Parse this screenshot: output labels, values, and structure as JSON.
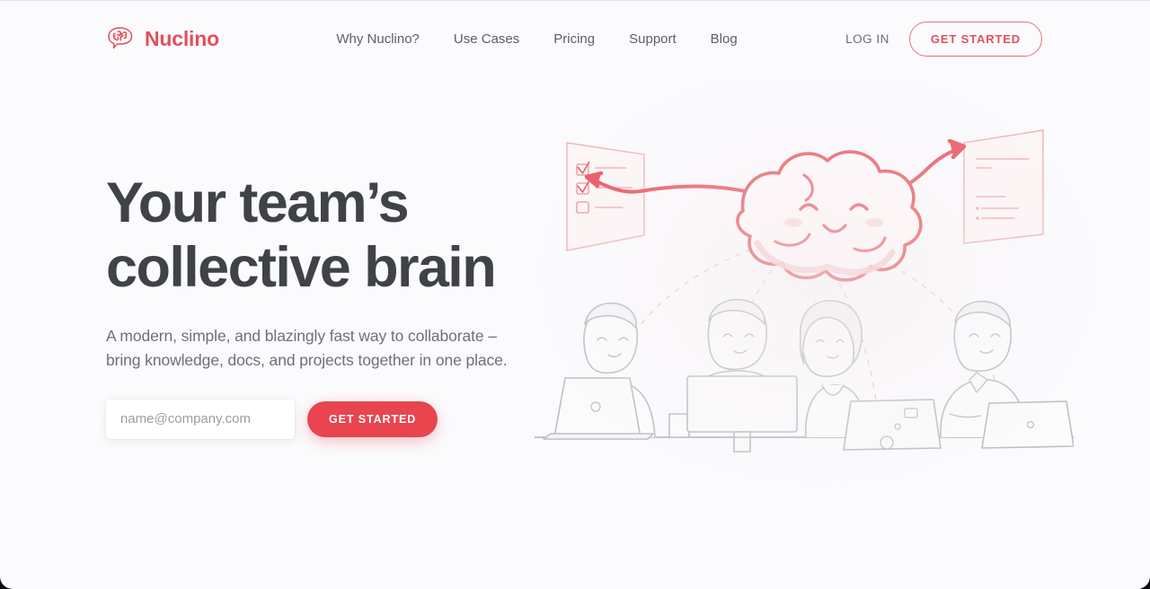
{
  "brand": {
    "name": "Nuclino",
    "logo_icon": "brain-speech-bubble-icon",
    "color": "#e0515d"
  },
  "header": {
    "nav": [
      {
        "label": "Why Nuclino?",
        "name": "nav-why-nuclino"
      },
      {
        "label": "Use Cases",
        "name": "nav-use-cases"
      },
      {
        "label": "Pricing",
        "name": "nav-pricing"
      },
      {
        "label": "Support",
        "name": "nav-support"
      },
      {
        "label": "Blog",
        "name": "nav-blog"
      }
    ],
    "login_label": "LOG IN",
    "get_started_label": "GET STARTED"
  },
  "hero": {
    "headline_line1": "Your team’s",
    "headline_line2": "collective brain",
    "subhead_line1": "A modern, simple, and blazingly fast way to collaborate –",
    "subhead_line2": "bring knowledge, docs, and projects together in one place.",
    "email_placeholder": "name@company.com",
    "email_value": "",
    "cta_label": "GET STARTED"
  },
  "illustration": {
    "name": "team-collective-brain-illustration",
    "cloud": "smiling-cloud-brain-icon",
    "left_panel": "checklist-board-icon",
    "right_panel": "notes-board-icon",
    "people_count": 4,
    "line_color": "#e8545f",
    "sketch_color": "#b9bbc0"
  },
  "colors": {
    "accent_red": "#e8454f",
    "brand_pink": "#e0515d",
    "headline": "#3f4246",
    "body_text": "#6d7075",
    "page_background": "#fbfbfd"
  }
}
